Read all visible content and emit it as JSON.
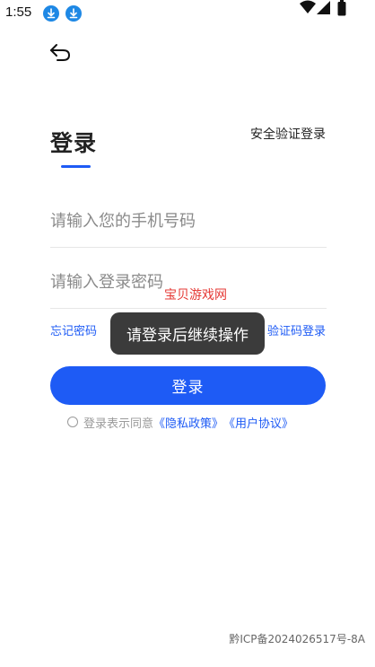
{
  "status_bar": {
    "time": "1:55",
    "icons": [
      "download-icon",
      "download-icon",
      "wifi-icon",
      "signal-icon",
      "battery-icon"
    ]
  },
  "header": {
    "back_icon": "back-arrow-icon"
  },
  "login": {
    "title": "登录",
    "sms_login": "安全验证登录",
    "phone_placeholder": "请输入您的手机号码",
    "password_placeholder": "请输入登录密码",
    "forgot_password": "忘记密码",
    "code_login": "验证码登录",
    "button": "登录"
  },
  "agreement": {
    "prefix": "登录表示同意",
    "privacy": "《隐私政策》",
    "user": "《用户协议》"
  },
  "toast": {
    "text": "请登录后继续操作"
  },
  "watermark": {
    "text": "宝贝游戏网"
  },
  "footer": {
    "icp": "黔ICP备2024026517号-8A"
  },
  "colors": {
    "accent": "#1e5bf5",
    "toast_bg": "#3b3b3b",
    "watermark": "#e53935"
  }
}
